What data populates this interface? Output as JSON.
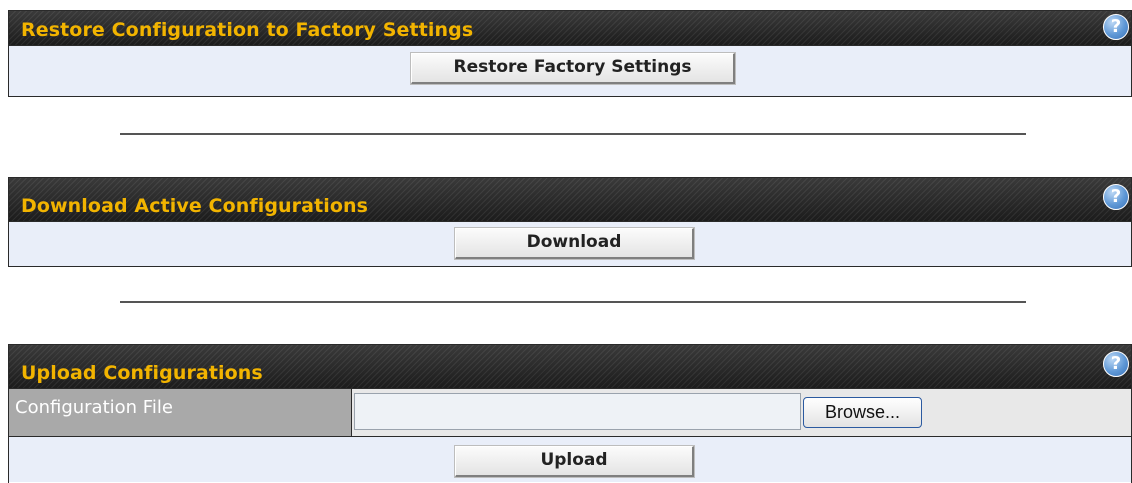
{
  "restore": {
    "title": "Restore Configuration to Factory Settings",
    "help_icon": "?",
    "button_label": "Restore Factory Settings"
  },
  "download": {
    "title": "Download Active Configurations",
    "help_icon": "?",
    "button_label": "Download"
  },
  "upload": {
    "title": "Upload Configurations",
    "help_icon": "?",
    "field_label": "Configuration File",
    "file_value": "",
    "browse_label": "Browse...",
    "button_label": "Upload"
  },
  "colors": {
    "header_bg": "#262626",
    "title_text": "#f2b400",
    "row_bg": "#e9eef9",
    "label_bg": "#a9a9a9"
  },
  "icons": {
    "help": "question-circle-icon"
  }
}
